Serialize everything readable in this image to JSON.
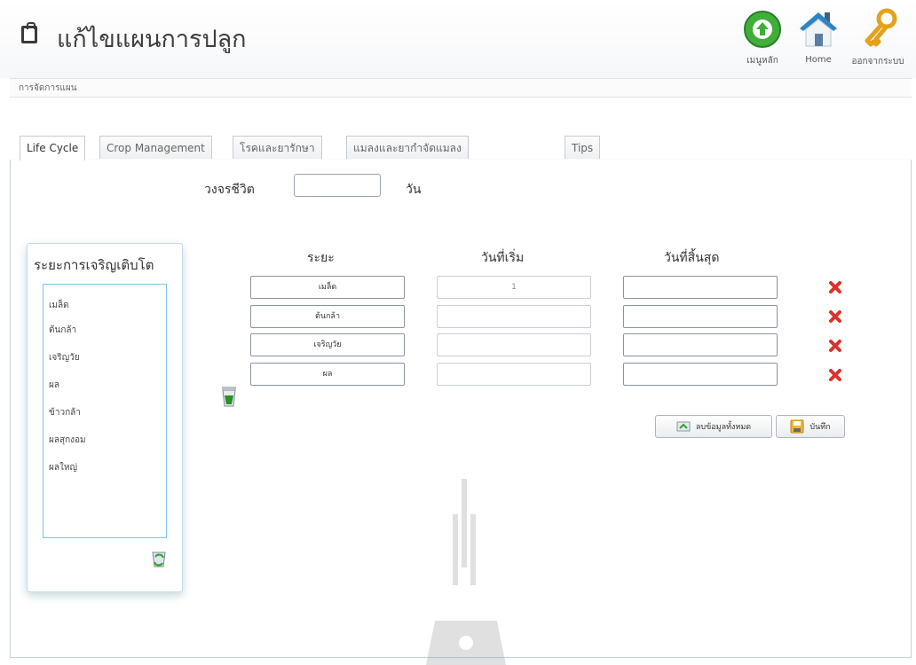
{
  "header": {
    "title": "แก้ไขแผนการปลูก",
    "nav": [
      {
        "label": "เมนูหลัก",
        "icon": "up-arrow-circle-icon"
      },
      {
        "label": "Home",
        "icon": "home-icon"
      },
      {
        "label": "ออกจากระบบ",
        "icon": "key-icon"
      }
    ]
  },
  "breadcrumb": "การจัดการแผน",
  "tabs": [
    {
      "label": "Life Cycle",
      "active": true
    },
    {
      "label": "Crop Management",
      "active": false
    },
    {
      "label": "โรคและยารักษา",
      "active": false
    },
    {
      "label": "แมลงและยากำจัดแมลง",
      "active": false
    },
    {
      "label": "Tips",
      "active": false
    }
  ],
  "lifecycle": {
    "label": "วงจรชีวิต",
    "value": "",
    "unit": "วัน"
  },
  "stages_panel": {
    "title": "ระยะการเจริญเติบโต",
    "items": [
      "เมล็ด",
      "ต้นกล้า",
      "เจริญวัย",
      "ผล",
      "ข้าวกล้า",
      "ผลสุกงอม",
      "ผลใหญ่"
    ]
  },
  "table": {
    "headers": [
      "ระยะ",
      "วันที่เริ่ม",
      "วันที่สิ้นสุด"
    ],
    "rows": [
      {
        "stage": "เมล็ด",
        "start": "1",
        "end": ""
      },
      {
        "stage": "ต้นกล้า",
        "start": "",
        "end": ""
      },
      {
        "stage": "เจริญวัย",
        "start": "",
        "end": ""
      },
      {
        "stage": "ผล",
        "start": "",
        "end": ""
      }
    ]
  },
  "buttons": {
    "clear_all": "ลบข้อมูลทั้งหมด",
    "save": "บันทึก"
  },
  "colors": {
    "accent": "#2a9ee0",
    "delete": "#d9332b",
    "tab_border": "#c5cbd3"
  }
}
